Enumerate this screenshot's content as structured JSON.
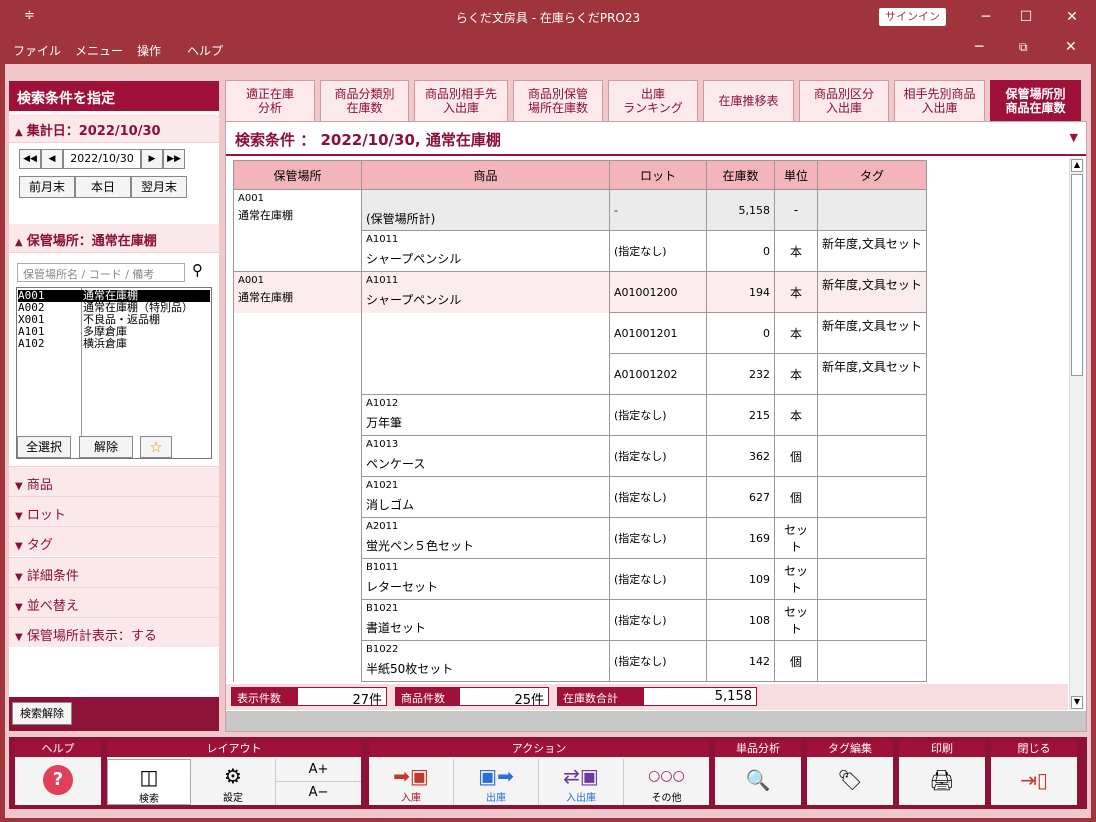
{
  "window": {
    "title": "らくだ文房具 - 在庫らくだPRO23",
    "signin": "サインイン",
    "minimize": "─",
    "maximize": "☐",
    "close": "✕"
  },
  "menu": {
    "items": [
      "ファイル",
      "メニュー",
      "操作",
      "ヘルプ"
    ]
  },
  "left": {
    "header": "検索条件を指定",
    "date_section": "集計日：2022/10/30",
    "date_value": "2022/10/30",
    "date_buttons": [
      "前月末",
      "本日",
      "翌月末"
    ],
    "location_section": "保管場所：通常在庫棚",
    "location_placeholder": "保管場所名 / コード / 備考",
    "locations": [
      {
        "code": "A001",
        "name": "通常在庫棚",
        "selected": true
      },
      {
        "code": "A002",
        "name": "通常在庫棚（特別品）",
        "selected": false
      },
      {
        "code": "X001",
        "name": "不良品・返品棚",
        "selected": false
      },
      {
        "code": "A101",
        "name": "多摩倉庫",
        "selected": false
      },
      {
        "code": "A102",
        "name": "横浜倉庫",
        "selected": false
      }
    ],
    "select_all": "全選択",
    "deselect": "解除",
    "collapsed_sections": [
      "商品",
      "ロット",
      "タグ",
      "詳細条件",
      "並べ替え",
      "保管場所計表示：する"
    ],
    "clear_search": "検索解除"
  },
  "tabs": [
    {
      "label": "適正在庫\n分析",
      "active": false
    },
    {
      "label": "商品分類別\n在庫数",
      "active": false
    },
    {
      "label": "商品別相手先\n入出庫",
      "active": false
    },
    {
      "label": "商品別保管\n場所在庫数",
      "active": false
    },
    {
      "label": "出庫\nランキング",
      "active": false
    },
    {
      "label": "在庫推移表",
      "active": false
    },
    {
      "label": "商品別区分\n入出庫",
      "active": false
    },
    {
      "label": "相手先別商品\n入出庫",
      "active": false
    },
    {
      "label": "保管場所別\n商品在庫数",
      "active": true
    }
  ],
  "condition": "検索条件 ： 2022/10/30, 通常在庫棚",
  "table": {
    "headers": [
      "保管場所",
      "商品",
      "ロット",
      "在庫数",
      "単位",
      "タグ"
    ],
    "loc_code": "A001",
    "loc_name": "通常在庫棚",
    "total_label": "(保管場所計)",
    "total_lot": "-",
    "total_qty": "5,158",
    "total_unit": "-",
    "rows": [
      {
        "code": "A1011",
        "name": "シャープペンシル",
        "lot": "(指定なし)",
        "qty": "0",
        "unit": "本",
        "tag": "新年度,文具セット"
      },
      {
        "code": "A1011",
        "name": "シャープペンシル",
        "lot": "A01001200",
        "qty": "194",
        "unit": "本",
        "tag": "新年度,文具セット"
      },
      {
        "code": "",
        "name": "",
        "lot": "A01001201",
        "qty": "0",
        "unit": "本",
        "tag": "新年度,文具セット"
      },
      {
        "code": "",
        "name": "",
        "lot": "A01001202",
        "qty": "232",
        "unit": "本",
        "tag": "新年度,文具セット"
      },
      {
        "code": "A1012",
        "name": "万年筆",
        "lot": "(指定なし)",
        "qty": "215",
        "unit": "本",
        "tag": ""
      },
      {
        "code": "A1013",
        "name": "ペンケース",
        "lot": "(指定なし)",
        "qty": "362",
        "unit": "個",
        "tag": ""
      },
      {
        "code": "A1021",
        "name": "消しゴム",
        "lot": "(指定なし)",
        "qty": "627",
        "unit": "個",
        "tag": ""
      },
      {
        "code": "A2011",
        "name": "蛍光ペン５色セット",
        "lot": "(指定なし)",
        "qty": "169",
        "unit": "セット",
        "tag": ""
      },
      {
        "code": "B1011",
        "name": "レターセット",
        "lot": "(指定なし)",
        "qty": "109",
        "unit": "セット",
        "tag": ""
      },
      {
        "code": "B1021",
        "name": "書道セット",
        "lot": "(指定なし)",
        "qty": "108",
        "unit": "セット",
        "tag": ""
      },
      {
        "code": "B1022",
        "name": "半紙50枚セット",
        "lot": "(指定なし)",
        "qty": "142",
        "unit": "個",
        "tag": ""
      }
    ]
  },
  "status": {
    "count_label": "表示件数",
    "count_value": "27件",
    "items_label": "商品件数",
    "items_value": "25件",
    "total_label": "在庫数合計",
    "total_value": "5,158"
  },
  "toolbar": {
    "help": {
      "title": "ヘルプ",
      "icon": "?"
    },
    "layout": {
      "title": "レイアウト",
      "search": "検索",
      "settings": "設定",
      "font_up": "A+",
      "font_down": "A−"
    },
    "action": {
      "title": "アクション",
      "in": "入庫",
      "out": "出庫",
      "inout": "入出庫",
      "other": "その他"
    },
    "analysis": {
      "title": "単品分析"
    },
    "tag_edit": {
      "title": "タグ編集"
    },
    "print": {
      "title": "印刷"
    },
    "close": {
      "title": "閉じる"
    }
  }
}
